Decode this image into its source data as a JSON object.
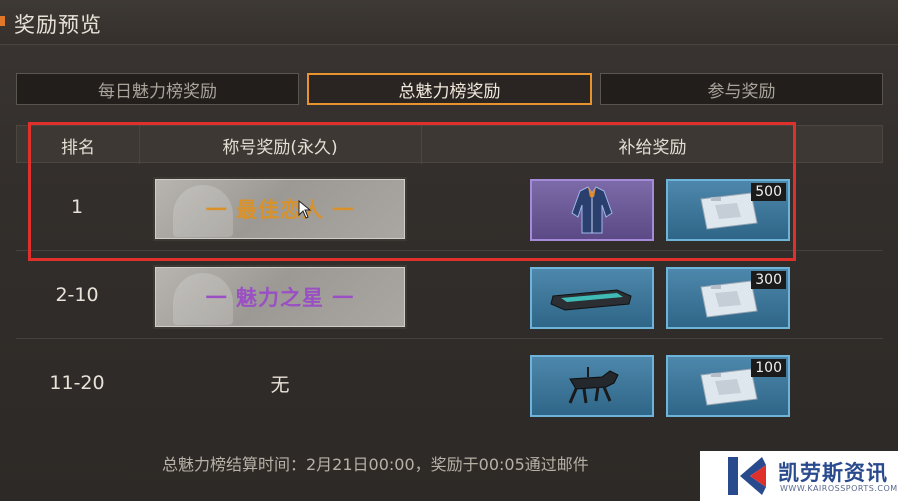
{
  "header": {
    "title": "奖励预览",
    "accent_color": "#e0782a"
  },
  "tabs": [
    {
      "label": "每日魅力榜奖励",
      "active": false
    },
    {
      "label": "总魅力榜奖励",
      "active": true
    },
    {
      "label": "参与奖励",
      "active": false
    }
  ],
  "table": {
    "columns": [
      "排名",
      "称号奖励(永久)",
      "补给奖励"
    ],
    "rows": [
      {
        "rank": "1",
        "title_reward": "一 最佳恋人 一",
        "title_color": "#d9922a",
        "items": [
          {
            "icon": "jacket-icon",
            "rarity": "purple",
            "qty": ""
          },
          {
            "icon": "supply-pack-icon",
            "rarity": "blue",
            "qty": "500"
          }
        ]
      },
      {
        "rank": "2-10",
        "title_reward": "一 魅力之星 一",
        "title_color": "#9a4fc4",
        "items": [
          {
            "icon": "skateboard-icon",
            "rarity": "blue",
            "qty": ""
          },
          {
            "icon": "supply-pack-icon",
            "rarity": "blue",
            "qty": "300"
          }
        ]
      },
      {
        "rank": "11-20",
        "title_reward": "无",
        "items": [
          {
            "icon": "robot-dog-icon",
            "rarity": "blue",
            "qty": ""
          },
          {
            "icon": "supply-pack-icon",
            "rarity": "blue",
            "qty": "100"
          }
        ]
      }
    ]
  },
  "footer": {
    "note": "总魅力榜结算时间：2月21日00:00，奖励于00:05通过邮件"
  },
  "watermark": {
    "title": "凯劳斯资讯",
    "subtitle": "WWW.KAIROSSPORTS.COM"
  }
}
